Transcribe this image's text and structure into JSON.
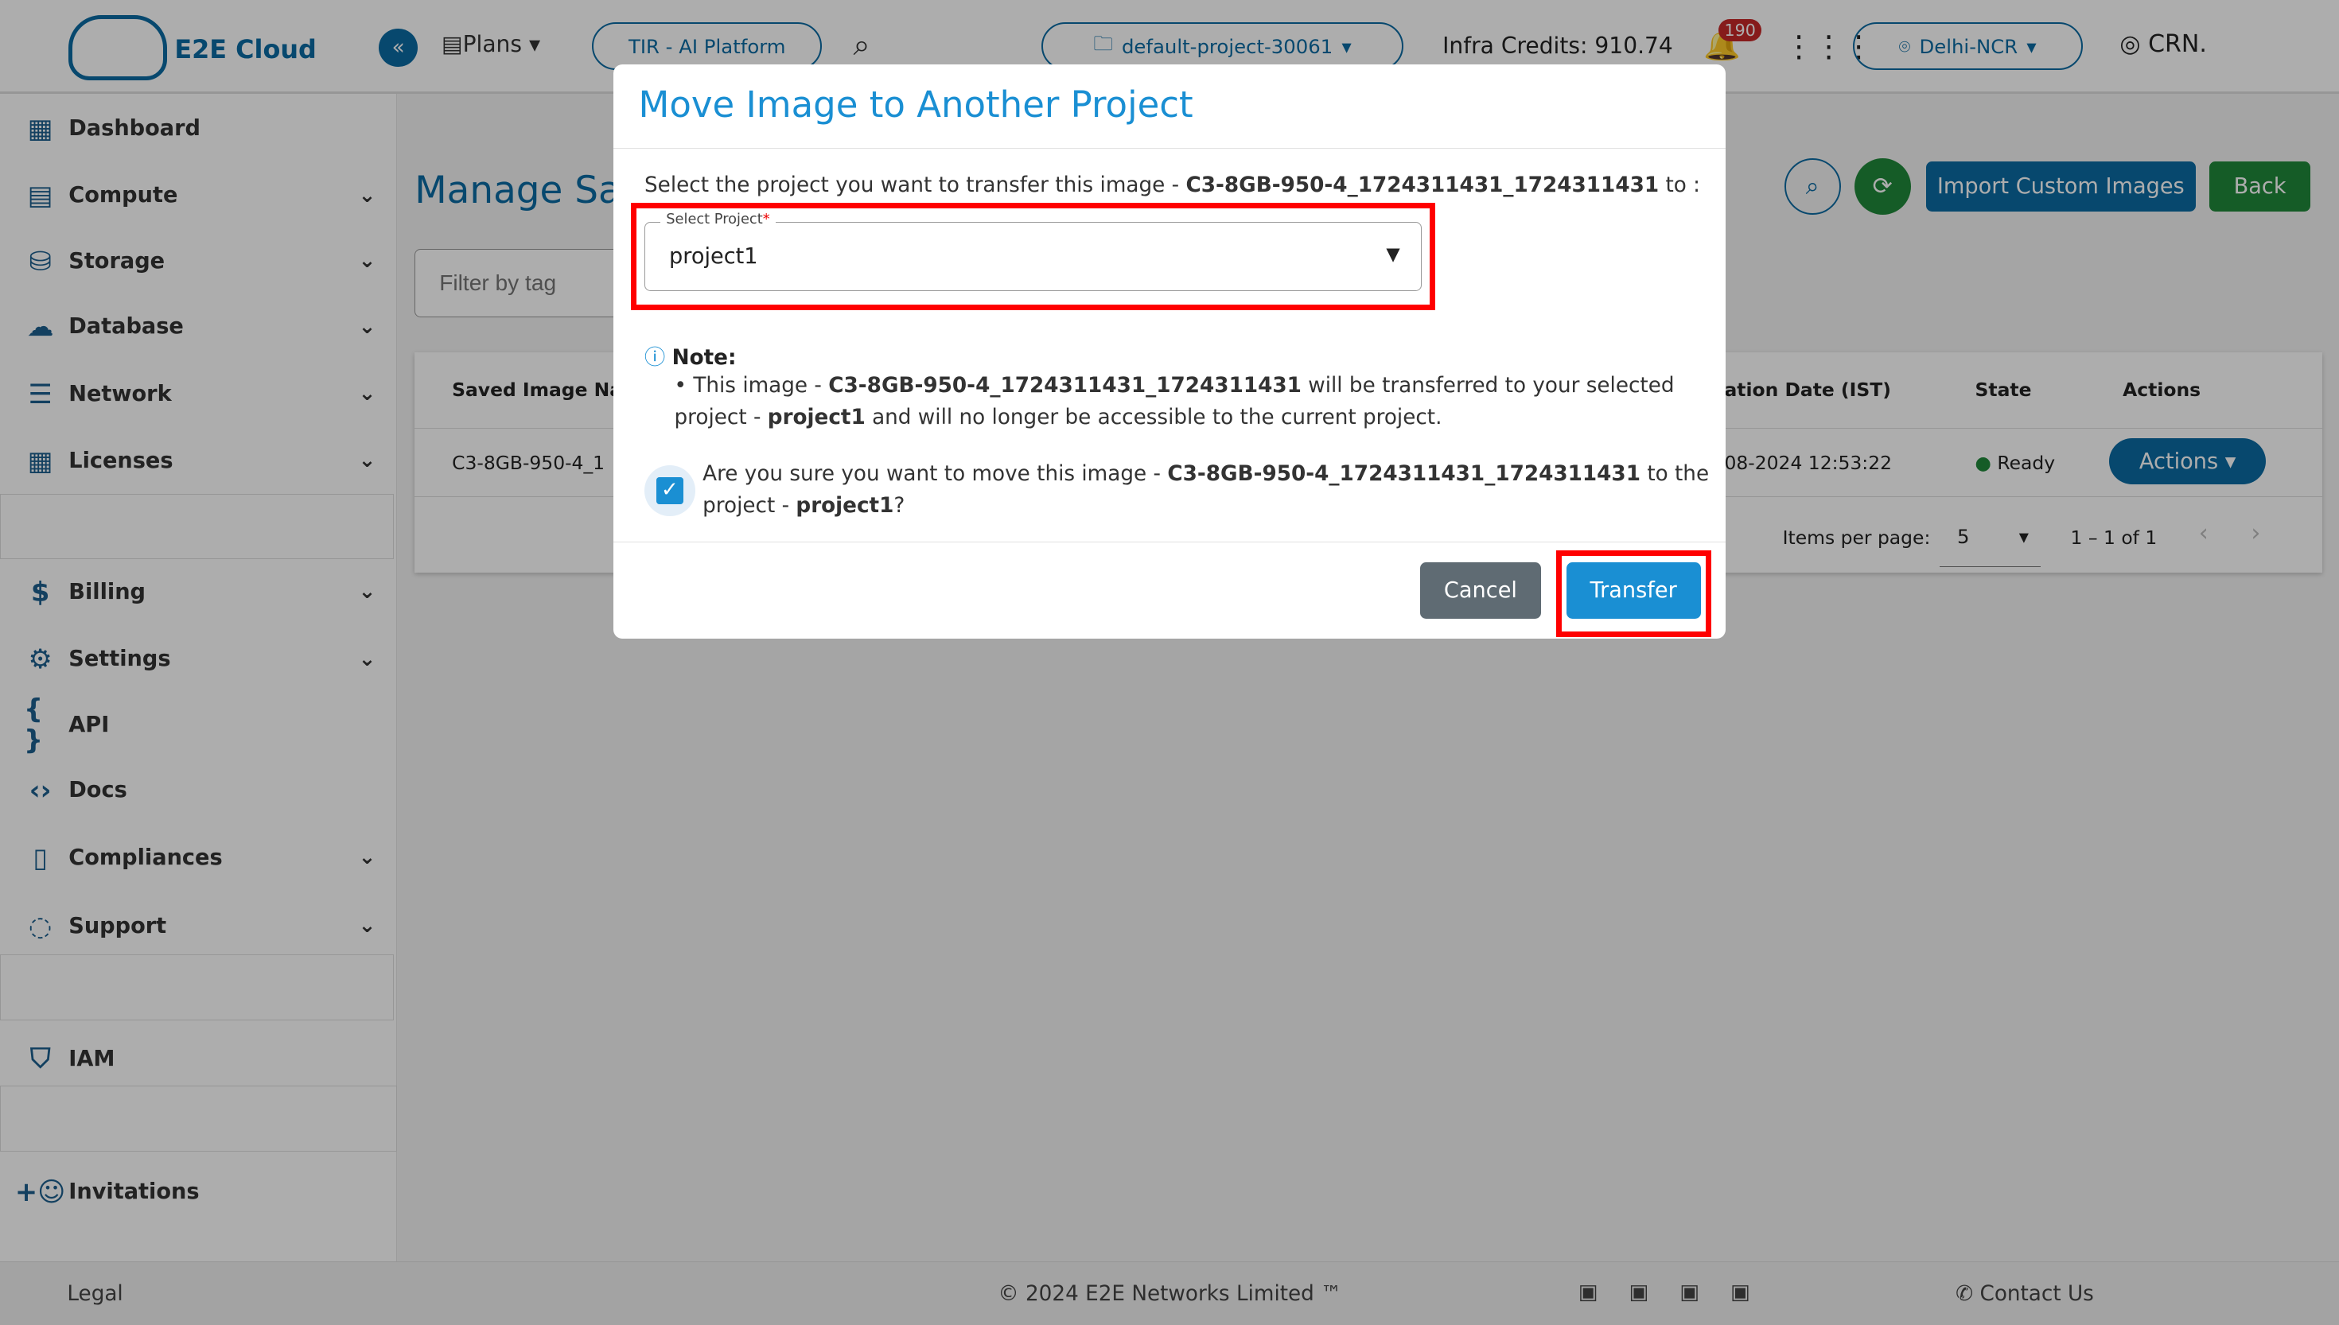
{
  "header": {
    "brand": "E2E Cloud",
    "logo_text": "E2E Cloud",
    "plans": "Plans",
    "tir": "TIR - AI Platform",
    "project": "default-project-30061",
    "credits": "Infra Credits: 910.74",
    "notifications": "190",
    "region": "Delhi-NCR",
    "user": "CRN."
  },
  "sidebar": {
    "items": [
      {
        "label": "Dashboard",
        "icon": "dashboard-icon"
      },
      {
        "label": "Compute",
        "icon": "compute-icon"
      },
      {
        "label": "Storage",
        "icon": "storage-icon"
      },
      {
        "label": "Database",
        "icon": "database-icon"
      },
      {
        "label": "Network",
        "icon": "network-icon"
      },
      {
        "label": "Licenses",
        "icon": "licenses-icon"
      },
      {
        "label": "Billing",
        "icon": "billing-icon"
      },
      {
        "label": "Settings",
        "icon": "gear-icon"
      },
      {
        "label": "API",
        "icon": "braces-icon"
      },
      {
        "label": "Docs",
        "icon": "code-icon"
      },
      {
        "label": "Compliances",
        "icon": "document-icon"
      },
      {
        "label": "Support",
        "icon": "support-icon"
      },
      {
        "label": "IAM",
        "icon": "iam-icon"
      },
      {
        "label": "Invitations",
        "icon": "add-user-icon"
      }
    ]
  },
  "main": {
    "title": "Manage Sav",
    "filter_placeholder": "Filter by tag",
    "import_label": "Import Custom Images",
    "back_label": "Back",
    "table": {
      "headers": [
        "Saved Image Nam",
        "ation Date (IST)",
        "State",
        "Actions"
      ],
      "row": {
        "name": "C3-8GB-950-4_1",
        "date": "08-2024 12:53:22",
        "state": "Ready",
        "actions": "Actions"
      }
    },
    "pagination": {
      "label": "Items per page:",
      "size": "5",
      "range": "1 – 1 of 1"
    }
  },
  "modal": {
    "title": "Move Image to Another Project",
    "intro_pre": "Select the project you want to transfer this image - ",
    "image": "C3-8GB-950-4_1724311431_1724311431",
    "intro_post": " to :",
    "select_label": "Select Project",
    "required": "*",
    "select_value": "project1",
    "note_title": "Note:",
    "note_1": "This image - ",
    "note_2": " will be transferred to your selected project - ",
    "note_3": " and will no longer be accessible to the current project.",
    "confirm_1": "Are you sure you want to move this image - ",
    "confirm_2": " to the project - ",
    "confirm_3": "?",
    "checked": true,
    "cancel": "Cancel",
    "transfer": "Transfer"
  },
  "footer": {
    "legal": "Legal",
    "copyright": "© 2024 E2E Networks Limited ™",
    "contact": "Contact Us"
  },
  "colors": {
    "primary": "#0b6aa2",
    "green": "#20883a",
    "highlight": "#ff0000",
    "badge": "#c62828"
  }
}
